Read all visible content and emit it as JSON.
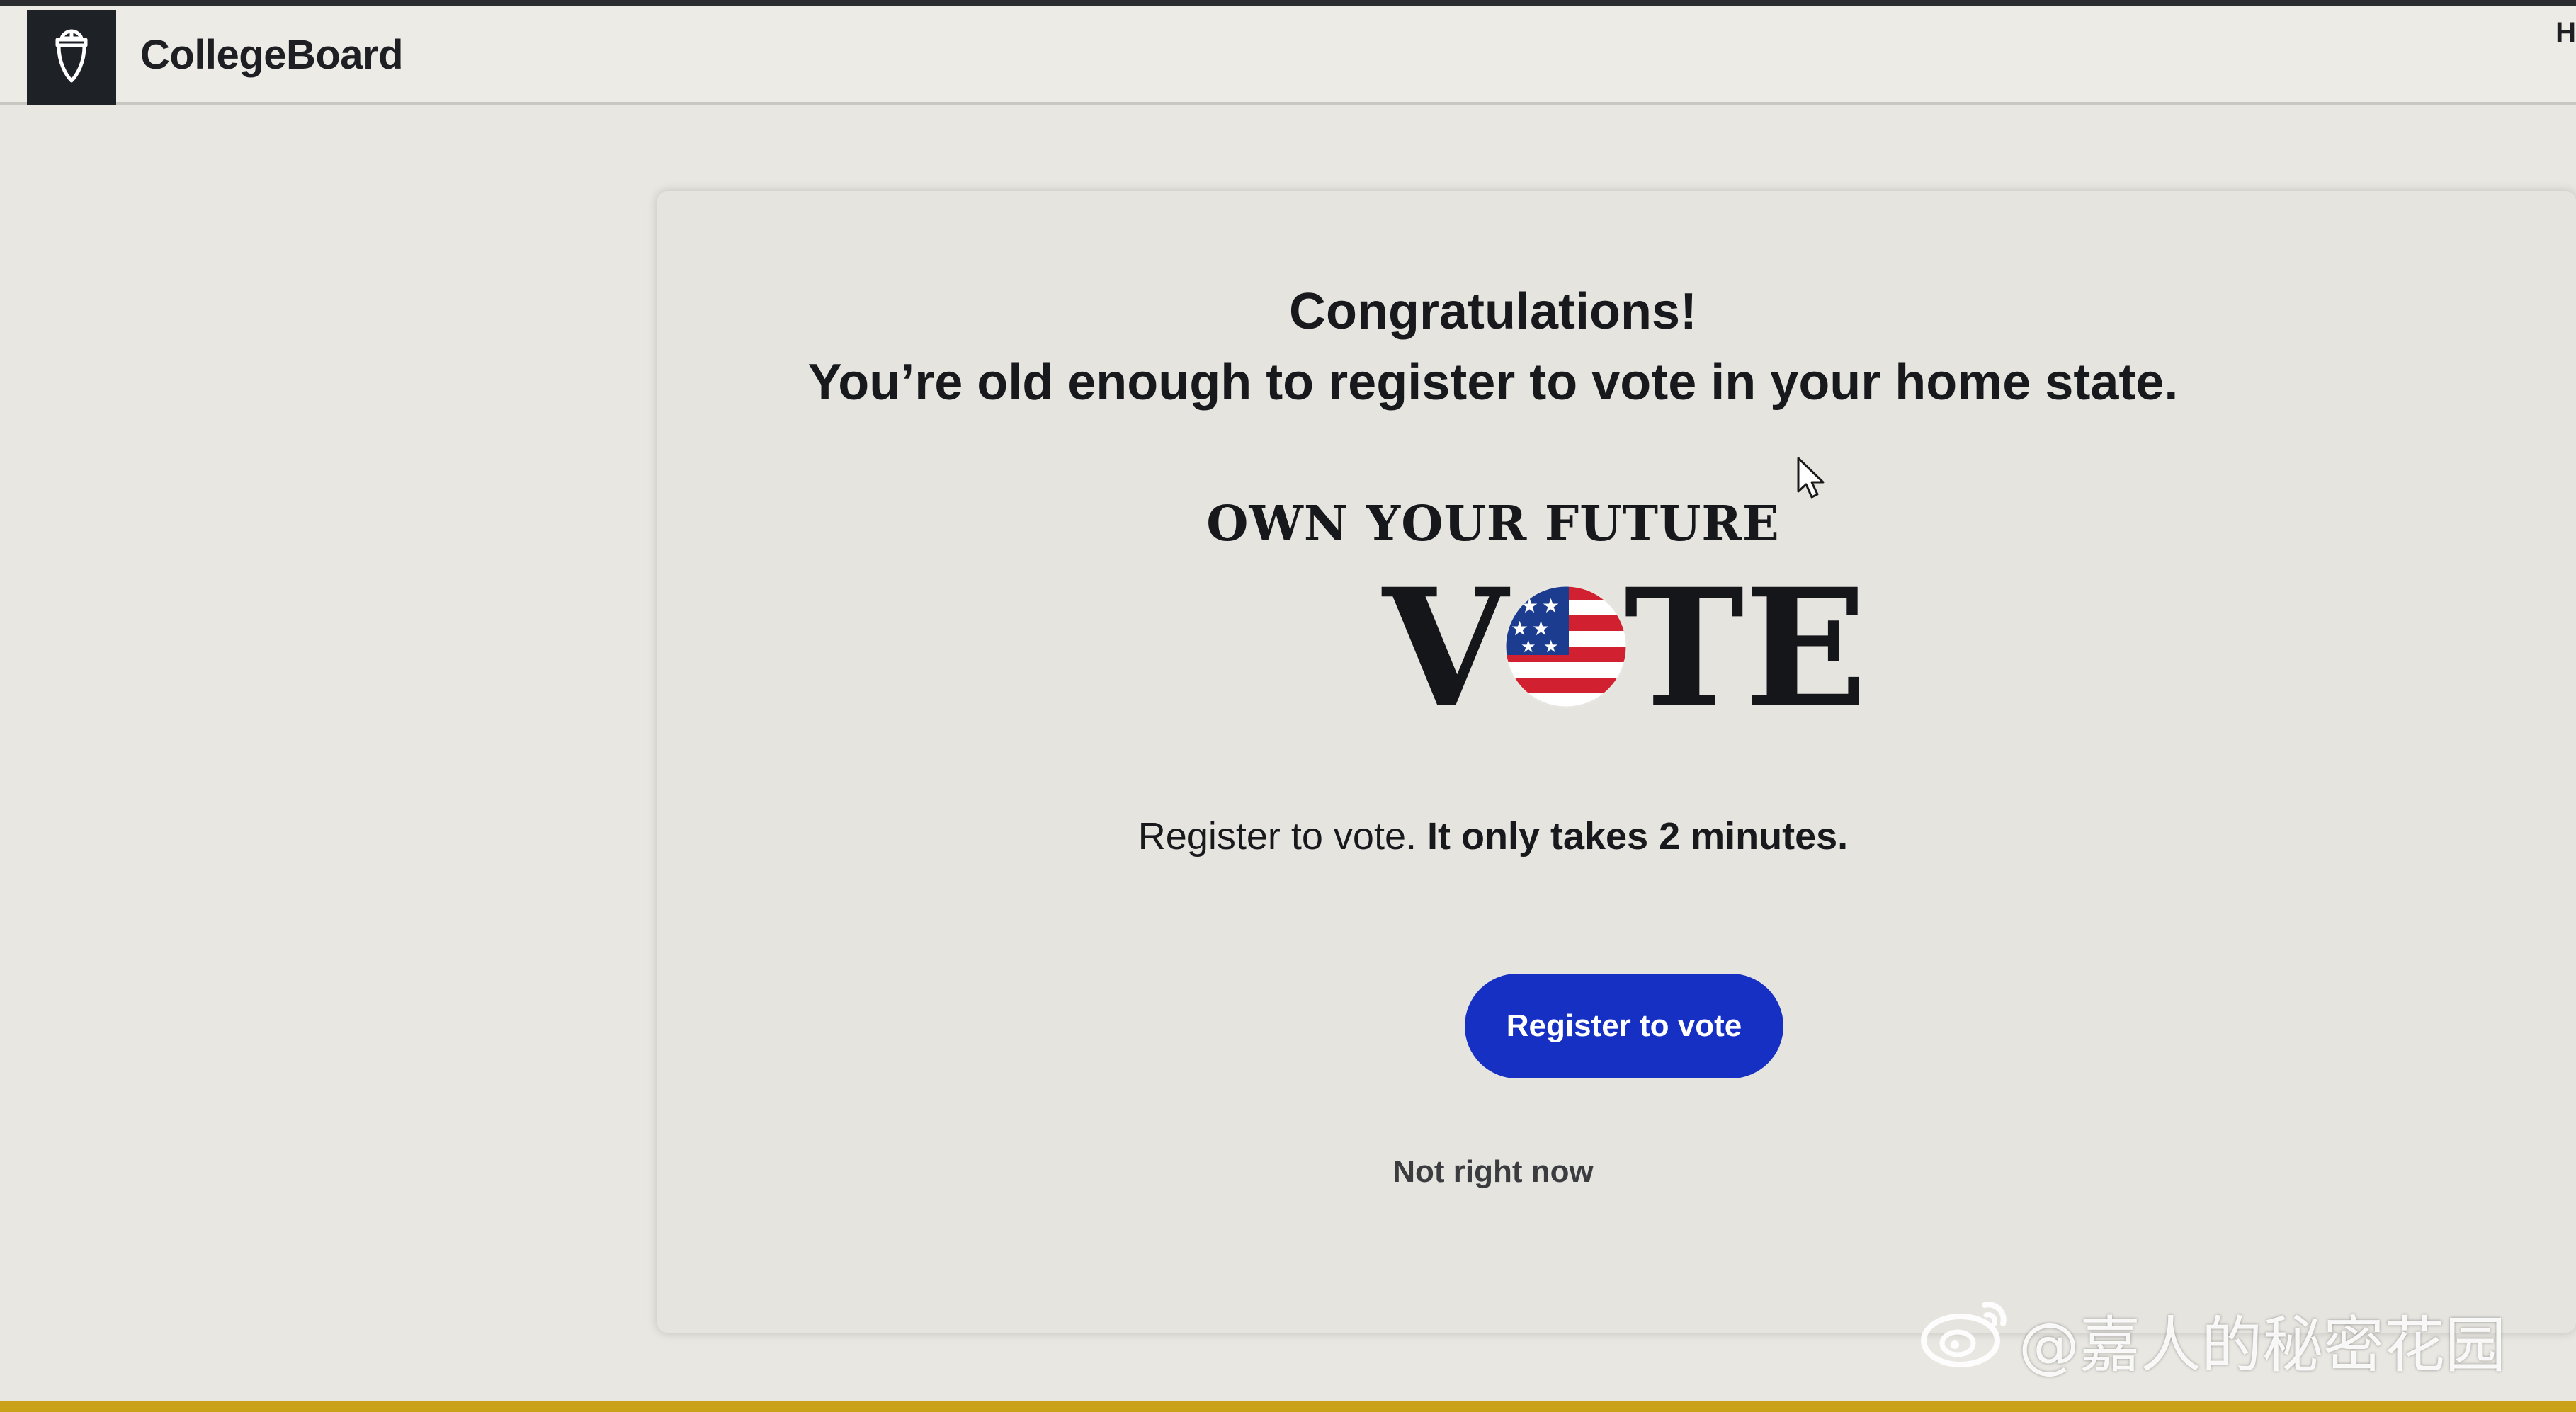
{
  "header": {
    "brand": "CollegeBoard",
    "right_text": "H"
  },
  "card": {
    "heading_line1": "Congratulations!",
    "heading_line2": "You’re old enough to register to vote in your home state.",
    "logo": {
      "tagline": "OWN YOUR FUTURE",
      "letter_v": "V",
      "letters_te": "TE"
    },
    "register_text_plain": "Register to vote. ",
    "register_text_bold": "It only takes 2 minutes.",
    "register_button_label": "Register to vote",
    "not_now_label": "Not right now"
  },
  "watermark": {
    "text": "@嘉人的秘密花园"
  },
  "colors": {
    "button_blue": "#1630c4",
    "flag_red": "#d1202f",
    "flag_blue": "#1b3c8f",
    "header_dark": "#1e2126"
  },
  "icons": {
    "logo": "acorn-icon",
    "cursor": "mouse-pointer-icon",
    "watermark": "weibo-icon",
    "flag": "us-flag-circle-icon"
  }
}
